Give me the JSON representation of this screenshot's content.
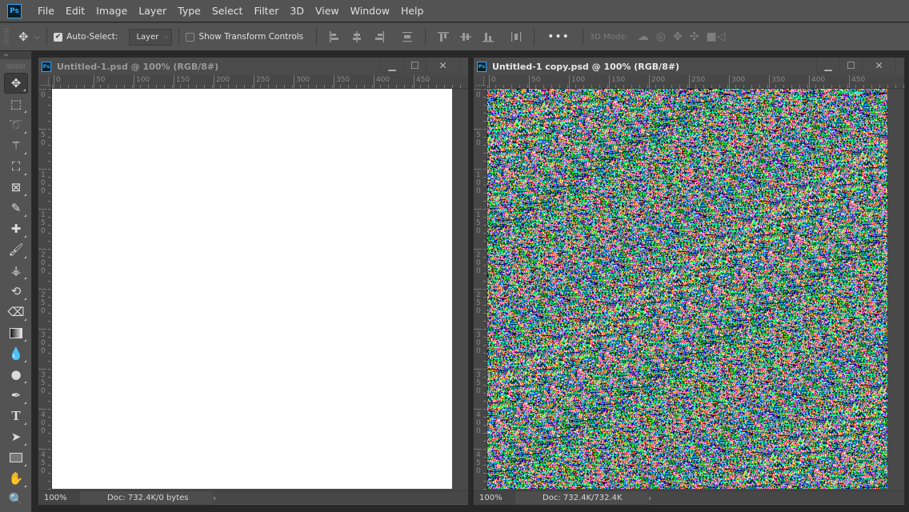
{
  "app": {
    "logo": "Ps",
    "menu": [
      "File",
      "Edit",
      "Image",
      "Layer",
      "Type",
      "Select",
      "Filter",
      "3D",
      "View",
      "Window",
      "Help"
    ]
  },
  "options_bar": {
    "move_icon": "move-arrows-icon",
    "auto_select_label": "Auto-Select:",
    "auto_select_checked": true,
    "auto_select_target": "Layer",
    "show_transform_label": "Show Transform Controls",
    "show_transform_checked": false,
    "more_label": "•••",
    "mode_3d_label": "3D Mode:"
  },
  "toolbar": {
    "collapse_label": "››",
    "tools": [
      {
        "name": "move-tool",
        "glyph": "✥",
        "active": true
      },
      {
        "name": "rectangular-marquee-tool",
        "glyph": "⬚"
      },
      {
        "name": "lasso-tool",
        "glyph": "➰"
      },
      {
        "name": "magic-wand-tool",
        "glyph": "⚚"
      },
      {
        "name": "crop-tool",
        "glyph": "⛶"
      },
      {
        "name": "frame-tool",
        "glyph": "⊠"
      },
      {
        "name": "eyedropper-tool",
        "glyph": "✎"
      },
      {
        "name": "healing-brush-tool",
        "glyph": "✚"
      },
      {
        "name": "brush-tool",
        "glyph": "🖌"
      },
      {
        "name": "clone-stamp-tool",
        "glyph": "⚶"
      },
      {
        "name": "history-brush-tool",
        "glyph": "⟲"
      },
      {
        "name": "eraser-tool",
        "glyph": "⌫"
      },
      {
        "name": "gradient-tool",
        "glyph": "▤"
      },
      {
        "name": "blur-tool",
        "glyph": "💧"
      },
      {
        "name": "dodge-tool",
        "glyph": "●"
      },
      {
        "name": "pen-tool",
        "glyph": "✒"
      },
      {
        "name": "type-tool",
        "glyph": "T"
      },
      {
        "name": "path-selection-tool",
        "glyph": "➤"
      },
      {
        "name": "rectangle-tool",
        "glyph": "▭"
      },
      {
        "name": "hand-tool",
        "glyph": "✋"
      },
      {
        "name": "zoom-tool",
        "glyph": "🔍"
      }
    ]
  },
  "documents": [
    {
      "title": "Untitled-1.psd @ 100% (RGB/8#)",
      "active": false,
      "ruler_h": [
        "0",
        "50",
        "100",
        "150",
        "200",
        "250",
        "300",
        "350",
        "400",
        "450"
      ],
      "ruler_v": [
        "0",
        "50",
        "100",
        "150",
        "200",
        "250",
        "300",
        "350",
        "400",
        "450"
      ],
      "canvas_fill": "white",
      "zoom": "100%",
      "doc_info": "Doc: 732.4K/0 bytes"
    },
    {
      "title": "Untitled-1 copy.psd @ 100% (RGB/8#)",
      "active": true,
      "ruler_h": [
        "0",
        "50",
        "100",
        "150",
        "200",
        "250",
        "300",
        "350",
        "400",
        "450"
      ],
      "ruler_v": [
        "0",
        "50",
        "100",
        "150",
        "200",
        "250",
        "300",
        "350",
        "400",
        "450"
      ],
      "canvas_fill": "rgb-noise",
      "zoom": "100%",
      "doc_info": "Doc: 732.4K/732.4K"
    }
  ],
  "window_controls": {
    "minimize": "▁",
    "maximize": "☐",
    "close": "✕"
  },
  "colors": {
    "ps_blue": "#31a8ff",
    "ui_gray": "#535353",
    "noise_palette": [
      "#ff0000",
      "#00ff00",
      "#0000ff",
      "#00ffff",
      "#ff00ff",
      "#ffff00",
      "#000000",
      "#ffffff"
    ]
  }
}
